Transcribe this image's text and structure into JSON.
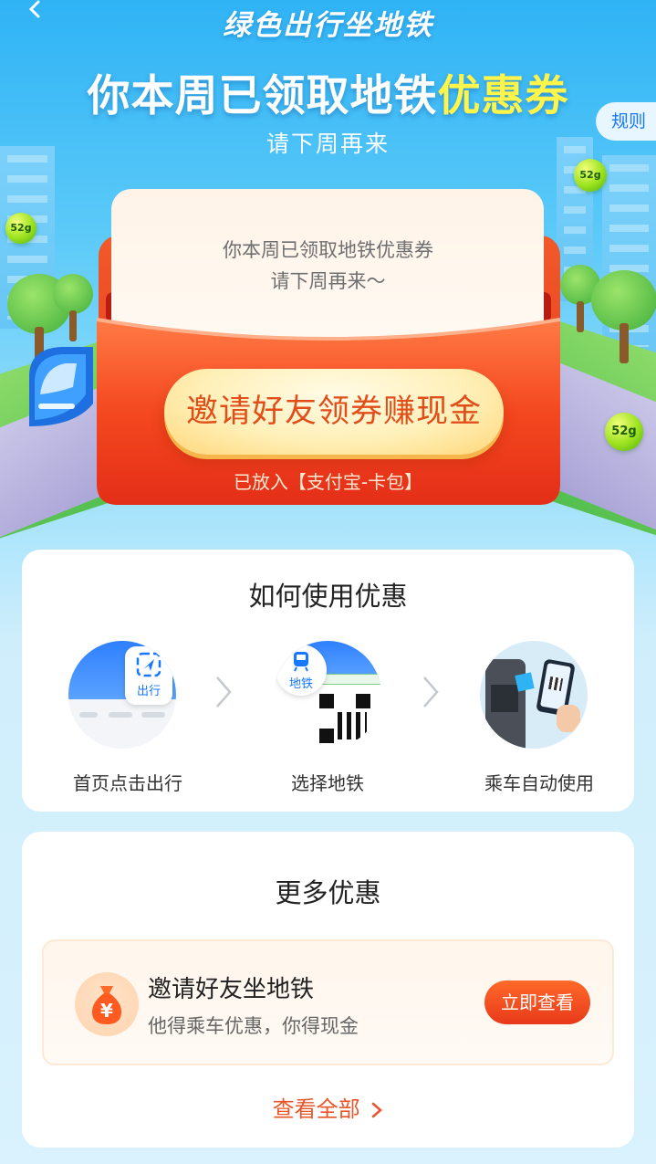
{
  "header": {
    "brand_title": "绿色出行坐地铁",
    "headline_main": "你本周已领取地铁",
    "headline_highlight": "优惠券",
    "subline": "请下周再来",
    "rules_label": "规则"
  },
  "energy_balls": [
    "52g",
    "52g",
    "52g"
  ],
  "coupon": {
    "line1": "你本周已领取地铁优惠券",
    "line2": "请下周再来～",
    "cta_label": "邀请好友领券赚现金",
    "saved_note": "已放入【支付宝-卡包】"
  },
  "how_to": {
    "title": "如何使用优惠",
    "steps": [
      {
        "label": "首页点击出行",
        "icon": "navigation-icon",
        "icon_text": "出行"
      },
      {
        "label": "选择地铁",
        "icon": "subway-icon",
        "icon_text": "地铁"
      },
      {
        "label": "乘车自动使用",
        "icon": "turnstile-scan-icon"
      }
    ]
  },
  "more_offers": {
    "title": "更多优惠",
    "offer": {
      "icon": "money-bag-icon",
      "icon_symbol": "¥",
      "title": "邀请好友坐地铁",
      "description": "他得乘车优惠，你得现金",
      "button_label": "立即查看"
    },
    "view_all_label": "查看全部"
  },
  "colors": {
    "accent_orange": "#e8552a",
    "highlight_yellow": "#fff54a",
    "link_blue": "#1677ff"
  }
}
